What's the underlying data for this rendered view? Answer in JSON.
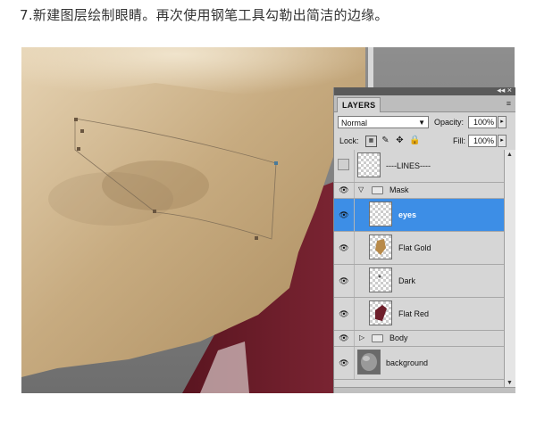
{
  "caption": "7.新建图层绘制眼睛。再次使用钢笔工具勾勒出简洁的边缘。",
  "panel": {
    "controls": "◂◂ ×",
    "tab": "LAYERS",
    "menu_icon": "≡",
    "blend_mode": "Normal",
    "opacity_label": "Opacity:",
    "opacity_value": "100%",
    "lock_label": "Lock:",
    "fill_label": "Fill:",
    "fill_value": "100%",
    "layers": [
      {
        "name": "----LINES----",
        "visible": false
      },
      {
        "name": "Mask",
        "type": "group",
        "expanded": true,
        "visible": true
      },
      {
        "name": "eyes",
        "visible": true,
        "selected": true
      },
      {
        "name": "Flat Gold",
        "visible": true
      },
      {
        "name": "Dark",
        "visible": true
      },
      {
        "name": "Flat Red",
        "visible": true
      },
      {
        "name": "Body",
        "type": "group",
        "expanded": false,
        "visible": true
      },
      {
        "name": "background",
        "visible": true
      }
    ]
  },
  "icons": {
    "visibility": "eye-icon",
    "lock_transparent": "checker-lock-icon",
    "lock_paint": "brush-lock-icon",
    "lock_move": "move-lock-icon",
    "lock_all": "padlock-icon"
  },
  "colors": {
    "selected_layer": "#3d8ee6",
    "mask_gold": "#c9ad84",
    "mask_red": "#6e1f2b"
  }
}
